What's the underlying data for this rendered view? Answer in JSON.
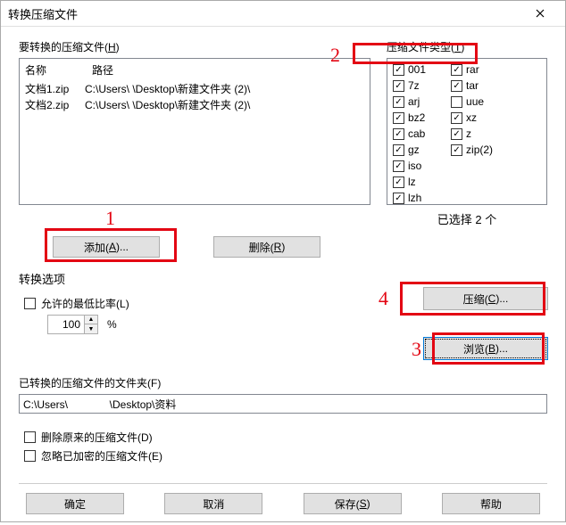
{
  "window": {
    "title": "转换压缩文件"
  },
  "filesGroup": {
    "label_pre": "要转换的压缩文件(",
    "label_key": "H",
    "label_post": ")",
    "header": {
      "name": "名称",
      "path": "路径"
    },
    "rows": [
      {
        "name": "文档1.zip",
        "path": "C:\\Users\\             \\Desktop\\新建文件夹 (2)\\"
      },
      {
        "name": "文档2.zip",
        "path": "C:\\Users\\             \\Desktop\\新建文件夹 (2)\\"
      }
    ],
    "addBtn_pre": "添加(",
    "addBtn_key": "A",
    "addBtn_post": ")...",
    "delBtn_pre": "删除(",
    "delBtn_key": "R",
    "delBtn_post": ")"
  },
  "typesGroup": {
    "label_pre": "压缩文件类型(",
    "label_key": "T",
    "label_post": ")",
    "col1": [
      {
        "label": "001",
        "checked": true
      },
      {
        "label": "7z",
        "checked": true
      },
      {
        "label": "arj",
        "checked": true
      },
      {
        "label": "bz2",
        "checked": true
      },
      {
        "label": "cab",
        "checked": true
      },
      {
        "label": "gz",
        "checked": true
      },
      {
        "label": "iso",
        "checked": true
      },
      {
        "label": "lz",
        "checked": true
      },
      {
        "label": "lzh",
        "checked": true
      }
    ],
    "col2": [
      {
        "label": "rar",
        "checked": true
      },
      {
        "label": "tar",
        "checked": true
      },
      {
        "label": "uue",
        "checked": false
      },
      {
        "label": "xz",
        "checked": true
      },
      {
        "label": "z",
        "checked": true
      },
      {
        "label": "zip(2)",
        "checked": true
      }
    ],
    "selectedCount": "已选择 2 个"
  },
  "options": {
    "sectionLabel": "转换选项",
    "minRatio_pre": "允许的最低比率(",
    "minRatio_key": "L",
    "minRatio_post": ")",
    "ratioValue": "100",
    "pct": "%",
    "compress_pre": "压缩(",
    "compress_key": "C",
    "compress_post": ")...",
    "browse_pre": "浏览(",
    "browse_key": "B",
    "browse_post": ")...",
    "folderLabel_pre": "已转换的压缩文件的文件夹(",
    "folderLabel_key": "F",
    "folderLabel_post": ")",
    "folderValue": "C:\\Users\\              \\Desktop\\资料",
    "delOrig_pre": "删除原来的压缩文件(",
    "delOrig_key": "D",
    "delOrig_post": ")",
    "skipEnc_pre": "忽略已加密的压缩文件(",
    "skipEnc_key": "E",
    "skipEnc_post": ")"
  },
  "bottom": {
    "ok": "确定",
    "cancel": "取消",
    "save_pre": "保存(",
    "save_key": "S",
    "save_post": ")",
    "help": "帮助"
  },
  "annotations": {
    "n1": "1",
    "n2": "2",
    "n3": "3",
    "n4": "4"
  }
}
